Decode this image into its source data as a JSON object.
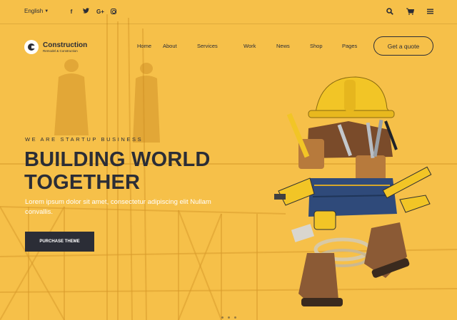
{
  "topbar": {
    "language": "English",
    "socials": [
      {
        "icon": "facebook-icon",
        "glyph": "f"
      },
      {
        "icon": "twitter-icon",
        "glyph": "t"
      },
      {
        "icon": "google-plus-icon",
        "glyph": "G+"
      },
      {
        "icon": "instagram-icon",
        "glyph": ""
      }
    ],
    "icons": [
      "search-icon",
      "cart-icon",
      "menu-icon"
    ]
  },
  "logo": {
    "name": "Construction",
    "tagline": "Remodel & Construction"
  },
  "nav": {
    "items": [
      "Home",
      "About",
      "Services",
      "Work",
      "News",
      "Shop",
      "Pages"
    ]
  },
  "header": {
    "cta_label": "Get a quote"
  },
  "hero": {
    "eyebrow": "WE ARE STARTUP BUSINESS",
    "headline_line1": "BUILDING WORLD",
    "headline_line2": "TOGETHER",
    "subtext": "Lorem ipsum dolor sit amet, consectetur adipiscing elit Nullam convallis.",
    "button_label": "PURCHASE THEME"
  },
  "colors": {
    "background": "#f6c049",
    "dark": "#2b2d36",
    "white": "#ffffff"
  }
}
